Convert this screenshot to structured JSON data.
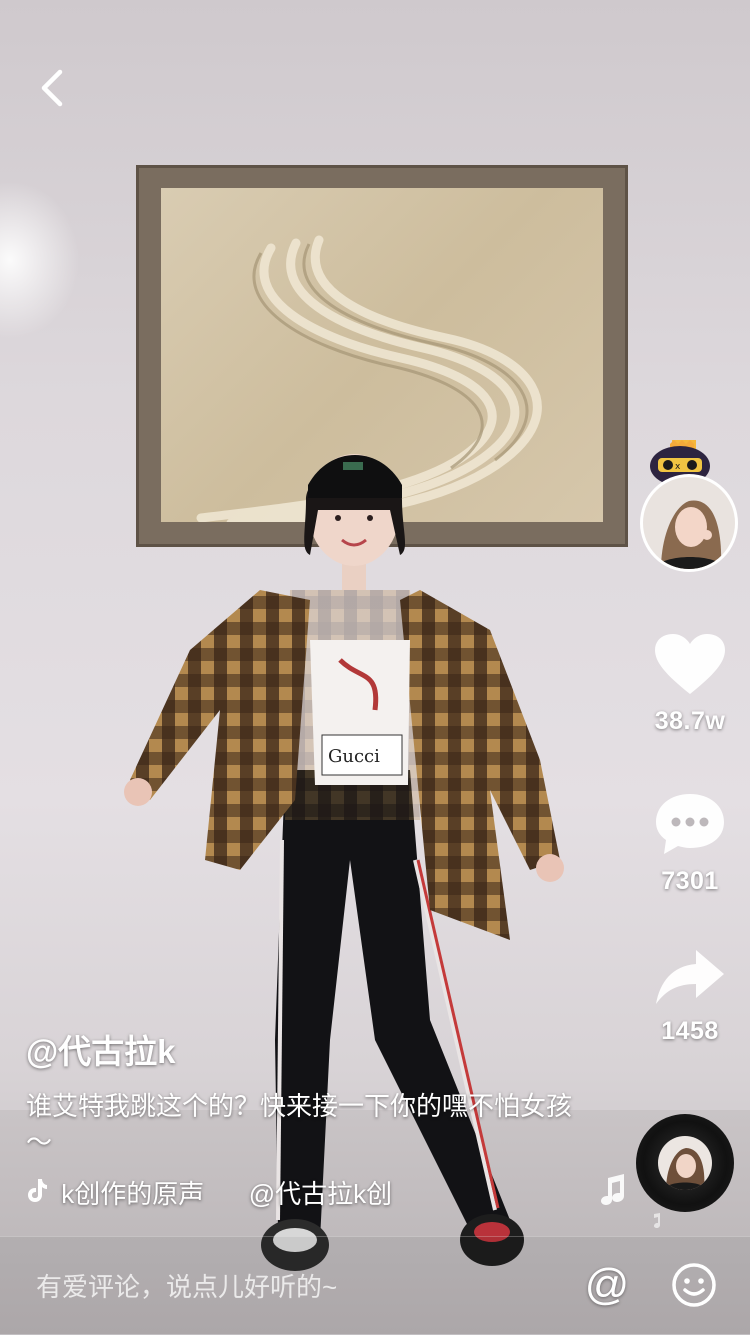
{
  "author": {
    "handle": "@代古拉k",
    "avatar_icon": "author-avatar"
  },
  "video": {
    "description": "谁艾特我跳这个的？快来接一下你的嘿不怕女孩～"
  },
  "music": {
    "icon": "tiktok-note-icon",
    "title": "k创作的原声",
    "artist": "@代古拉k创"
  },
  "actions": {
    "likes": "38.7w",
    "comments": "7301",
    "shares": "1458"
  },
  "comment_bar": {
    "placeholder": "有爱评论，说点儿好听的~",
    "at_symbol": "@"
  },
  "colors": {
    "text": "#ffffff",
    "background": "#d8d3d6"
  }
}
